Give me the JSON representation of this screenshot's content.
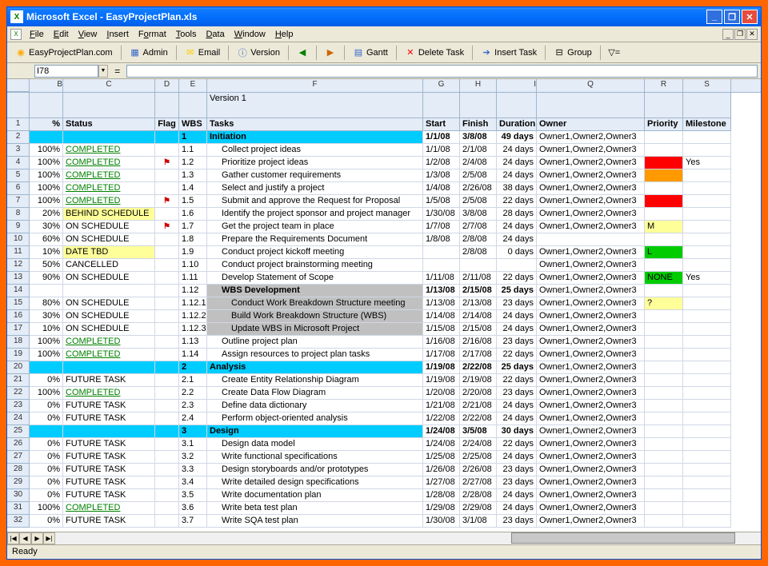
{
  "window": {
    "app": "Microsoft Excel",
    "file": "EasyProjectPlan.xls",
    "title": "Microsoft Excel - EasyProjectPlan.xls"
  },
  "menus": [
    "File",
    "Edit",
    "View",
    "Insert",
    "Format",
    "Tools",
    "Data",
    "Window",
    "Help"
  ],
  "toolbar": {
    "site": "EasyProjectPlan.com",
    "admin": "Admin",
    "email": "Email",
    "version": "Version",
    "gantt": "Gantt",
    "delete_task": "Delete Task",
    "insert_task": "Insert Task",
    "group": "Group"
  },
  "namebox": "I78",
  "formula": "=",
  "version_label": "Version 1",
  "columns": [
    "B",
    "C",
    "D",
    "E",
    "F",
    "G",
    "H",
    "I",
    "Q",
    "R",
    "S"
  ],
  "headers": {
    "pct": "%",
    "status": "Status",
    "flag": "Flag",
    "wbs": "WBS",
    "tasks": "Tasks",
    "start": "Start",
    "finish": "Finish",
    "duration": "Duration",
    "owner": "Owner",
    "priority": "Priority",
    "milestone": "Milestone"
  },
  "rows": [
    {
      "n": 2,
      "pct": "",
      "status": "",
      "flag": "",
      "wbs": "1",
      "task": "Initiation",
      "start": "1/1/08",
      "finish": "3/8/08",
      "dur": "49 days",
      "owner": "Owner1,Owner2,Owner3",
      "pri": "",
      "ms": "",
      "section": true
    },
    {
      "n": 3,
      "pct": "100%",
      "status": "COMPLETED",
      "sc": true,
      "flag": "",
      "wbs": "1.1",
      "task": "Collect project ideas",
      "ind": 1,
      "start": "1/1/08",
      "finish": "2/1/08",
      "dur": "24 days",
      "owner": "Owner1,Owner2,Owner3",
      "pri": "",
      "ms": ""
    },
    {
      "n": 4,
      "pct": "100%",
      "status": "COMPLETED",
      "sc": true,
      "flag": "🏴",
      "wbs": "1.2",
      "task": "Prioritize project ideas",
      "ind": 1,
      "start": "1/2/08",
      "finish": "2/4/08",
      "dur": "24 days",
      "owner": "Owner1,Owner2,Owner3",
      "pri": "",
      "pribg": "red",
      "ms": "Yes"
    },
    {
      "n": 5,
      "pct": "100%",
      "status": "COMPLETED",
      "sc": true,
      "flag": "",
      "wbs": "1.3",
      "task": "Gather customer requirements",
      "ind": 1,
      "start": "1/3/08",
      "finish": "2/5/08",
      "dur": "24 days",
      "owner": "Owner1,Owner2,Owner3",
      "pri": "",
      "pribg": "orange",
      "ms": ""
    },
    {
      "n": 6,
      "pct": "100%",
      "status": "COMPLETED",
      "sc": true,
      "flag": "",
      "wbs": "1.4",
      "task": "Select and justify a project",
      "ind": 1,
      "start": "1/4/08",
      "finish": "2/26/08",
      "dur": "38 days",
      "owner": "Owner1,Owner2,Owner3",
      "pri": "",
      "ms": ""
    },
    {
      "n": 7,
      "pct": "100%",
      "status": "COMPLETED",
      "sc": true,
      "flag": "🏴",
      "wbs": "1.5",
      "task": "Submit and approve the Request for Proposal",
      "ind": 1,
      "start": "1/5/08",
      "finish": "2/5/08",
      "dur": "22 days",
      "owner": "Owner1,Owner2,Owner3",
      "pri": "",
      "pribg": "red",
      "ms": ""
    },
    {
      "n": 8,
      "pct": "20%",
      "status": "BEHIND SCHEDULE",
      "sbg": "yellow",
      "flag": "",
      "wbs": "1.6",
      "task": "Identify the project sponsor and project manager",
      "ind": 1,
      "start": "1/30/08",
      "finish": "3/8/08",
      "dur": "28 days",
      "owner": "Owner1,Owner2,Owner3",
      "pri": "",
      "ms": ""
    },
    {
      "n": 9,
      "pct": "30%",
      "status": "ON SCHEDULE",
      "flag": "🏴",
      "wbs": "1.7",
      "task": "Get the project team in place",
      "ind": 1,
      "start": "1/7/08",
      "finish": "2/7/08",
      "dur": "24 days",
      "owner": "Owner1,Owner2,Owner3",
      "pri": "M",
      "pribg": "yellow",
      "ms": ""
    },
    {
      "n": 10,
      "pct": "60%",
      "status": "ON SCHEDULE",
      "flag": "",
      "wbs": "1.8",
      "task": "Prepare the Requirements Document",
      "ind": 1,
      "start": "1/8/08",
      "finish": "2/8/08",
      "dur": "24 days",
      "owner": "",
      "pri": "",
      "ms": ""
    },
    {
      "n": 11,
      "pct": "10%",
      "status": "DATE TBD",
      "sbg": "yellow",
      "flag": "",
      "wbs": "1.9",
      "task": "Conduct project kickoff meeting",
      "ind": 1,
      "start": "",
      "finish": "2/8/08",
      "dur": "0 days",
      "owner": "Owner1,Owner2,Owner3",
      "pri": "L",
      "pribg": "green",
      "ms": ""
    },
    {
      "n": 12,
      "pct": "50%",
      "status": "CANCELLED",
      "flag": "",
      "wbs": "1.10",
      "task": "Conduct project brainstorming meeting",
      "ind": 1,
      "start": "",
      "finish": "",
      "dur": "",
      "owner": "Owner1,Owner2,Owner3",
      "pri": "",
      "ms": ""
    },
    {
      "n": 13,
      "pct": "90%",
      "status": "ON SCHEDULE",
      "flag": "",
      "wbs": "1.11",
      "task": "Develop Statement of Scope",
      "ind": 1,
      "start": "1/11/08",
      "finish": "2/11/08",
      "dur": "22 days",
      "owner": "Owner1,Owner2,Owner3",
      "pri": "NONE",
      "pribg": "green",
      "ms": "Yes"
    },
    {
      "n": 14,
      "pct": "",
      "status": "",
      "flag": "",
      "wbs": "1.12",
      "task": "WBS Development",
      "ind": 1,
      "start": "1/13/08",
      "finish": "2/15/08",
      "dur": "25 days",
      "owner": "Owner1,Owner2,Owner3",
      "pri": "",
      "ms": "",
      "sub": true
    },
    {
      "n": 15,
      "pct": "80%",
      "status": "ON SCHEDULE",
      "flag": "",
      "wbs": "1.12.1",
      "task": "Conduct Work Breakdown Structure meeting",
      "ind": 2,
      "start": "1/13/08",
      "finish": "2/13/08",
      "dur": "23 days",
      "owner": "Owner1,Owner2,Owner3",
      "pri": "?",
      "pribg": "yellow",
      "ms": ""
    },
    {
      "n": 16,
      "pct": "30%",
      "status": "ON SCHEDULE",
      "flag": "",
      "wbs": "1.12.2",
      "task": "Build Work Breakdown Structure (WBS)",
      "ind": 2,
      "start": "1/14/08",
      "finish": "2/14/08",
      "dur": "24 days",
      "owner": "Owner1,Owner2,Owner3",
      "pri": "",
      "ms": ""
    },
    {
      "n": 17,
      "pct": "10%",
      "status": "ON SCHEDULE",
      "flag": "",
      "wbs": "1.12.3",
      "task": "Update WBS in Microsoft Project",
      "ind": 2,
      "start": "1/15/08",
      "finish": "2/15/08",
      "dur": "24 days",
      "owner": "Owner1,Owner2,Owner3",
      "pri": "",
      "ms": ""
    },
    {
      "n": 18,
      "pct": "100%",
      "status": "COMPLETED",
      "sc": true,
      "flag": "",
      "wbs": "1.13",
      "task": "Outline project plan",
      "ind": 1,
      "start": "1/16/08",
      "finish": "2/16/08",
      "dur": "23 days",
      "owner": "Owner1,Owner2,Owner3",
      "pri": "",
      "ms": ""
    },
    {
      "n": 19,
      "pct": "100%",
      "status": "COMPLETED",
      "sc": true,
      "flag": "",
      "wbs": "1.14",
      "task": "Assign resources to project plan tasks",
      "ind": 1,
      "start": "1/17/08",
      "finish": "2/17/08",
      "dur": "22 days",
      "owner": "Owner1,Owner2,Owner3",
      "pri": "",
      "ms": ""
    },
    {
      "n": 20,
      "pct": "",
      "status": "",
      "flag": "",
      "wbs": "2",
      "task": "Analysis",
      "start": "1/19/08",
      "finish": "2/22/08",
      "dur": "25 days",
      "owner": "Owner1,Owner2,Owner3",
      "pri": "",
      "ms": "",
      "section": true
    },
    {
      "n": 21,
      "pct": "0%",
      "status": "FUTURE TASK",
      "flag": "",
      "wbs": "2.1",
      "task": "Create Entity Relationship Diagram",
      "ind": 1,
      "start": "1/19/08",
      "finish": "2/19/08",
      "dur": "22 days",
      "owner": "Owner1,Owner2,Owner3",
      "pri": "",
      "ms": ""
    },
    {
      "n": 22,
      "pct": "100%",
      "status": "COMPLETED",
      "sc": true,
      "flag": "",
      "wbs": "2.2",
      "task": "Create Data Flow Diagram",
      "ind": 1,
      "start": "1/20/08",
      "finish": "2/20/08",
      "dur": "23 days",
      "owner": "Owner1,Owner2,Owner3",
      "pri": "",
      "ms": ""
    },
    {
      "n": 23,
      "pct": "0%",
      "status": "FUTURE TASK",
      "flag": "",
      "wbs": "2.3",
      "task": "Define data dictionary",
      "ind": 1,
      "start": "1/21/08",
      "finish": "2/21/08",
      "dur": "24 days",
      "owner": "Owner1,Owner2,Owner3",
      "pri": "",
      "ms": ""
    },
    {
      "n": 24,
      "pct": "0%",
      "status": "FUTURE TASK",
      "flag": "",
      "wbs": "2.4",
      "task": "Perform object-oriented analysis",
      "ind": 1,
      "start": "1/22/08",
      "finish": "2/22/08",
      "dur": "24 days",
      "owner": "Owner1,Owner2,Owner3",
      "pri": "",
      "ms": ""
    },
    {
      "n": 25,
      "pct": "",
      "status": "",
      "flag": "",
      "wbs": "3",
      "task": "Design",
      "start": "1/24/08",
      "finish": "3/5/08",
      "dur": "30 days",
      "owner": "Owner1,Owner2,Owner3",
      "pri": "",
      "ms": "",
      "section": true
    },
    {
      "n": 26,
      "pct": "0%",
      "status": "FUTURE TASK",
      "flag": "",
      "wbs": "3.1",
      "task": "Design data model",
      "ind": 1,
      "start": "1/24/08",
      "finish": "2/24/08",
      "dur": "22 days",
      "owner": "Owner1,Owner2,Owner3",
      "pri": "",
      "ms": ""
    },
    {
      "n": 27,
      "pct": "0%",
      "status": "FUTURE TASK",
      "flag": "",
      "wbs": "3.2",
      "task": "Write functional specifications",
      "ind": 1,
      "start": "1/25/08",
      "finish": "2/25/08",
      "dur": "24 days",
      "owner": "Owner1,Owner2,Owner3",
      "pri": "",
      "ms": ""
    },
    {
      "n": 28,
      "pct": "0%",
      "status": "FUTURE TASK",
      "flag": "",
      "wbs": "3.3",
      "task": "Design storyboards and/or prototypes",
      "ind": 1,
      "start": "1/26/08",
      "finish": "2/26/08",
      "dur": "23 days",
      "owner": "Owner1,Owner2,Owner3",
      "pri": "",
      "ms": ""
    },
    {
      "n": 29,
      "pct": "0%",
      "status": "FUTURE TASK",
      "flag": "",
      "wbs": "3.4",
      "task": "Write detailed design specifications",
      "ind": 1,
      "start": "1/27/08",
      "finish": "2/27/08",
      "dur": "23 days",
      "owner": "Owner1,Owner2,Owner3",
      "pri": "",
      "ms": ""
    },
    {
      "n": 30,
      "pct": "0%",
      "status": "FUTURE TASK",
      "flag": "",
      "wbs": "3.5",
      "task": "Write documentation plan",
      "ind": 1,
      "start": "1/28/08",
      "finish": "2/28/08",
      "dur": "24 days",
      "owner": "Owner1,Owner2,Owner3",
      "pri": "",
      "ms": ""
    },
    {
      "n": 31,
      "pct": "100%",
      "status": "COMPLETED",
      "sc": true,
      "flag": "",
      "wbs": "3.6",
      "task": "Write beta test plan",
      "ind": 1,
      "start": "1/29/08",
      "finish": "2/29/08",
      "dur": "24 days",
      "owner": "Owner1,Owner2,Owner3",
      "pri": "",
      "ms": ""
    },
    {
      "n": 32,
      "pct": "0%",
      "status": "FUTURE TASK",
      "flag": "",
      "wbs": "3.7",
      "task": "Write SQA test plan",
      "ind": 1,
      "start": "1/30/08",
      "finish": "3/1/08",
      "dur": "23 days",
      "owner": "Owner1,Owner2,Owner3",
      "pri": "",
      "ms": ""
    }
  ],
  "statusbar": "Ready"
}
